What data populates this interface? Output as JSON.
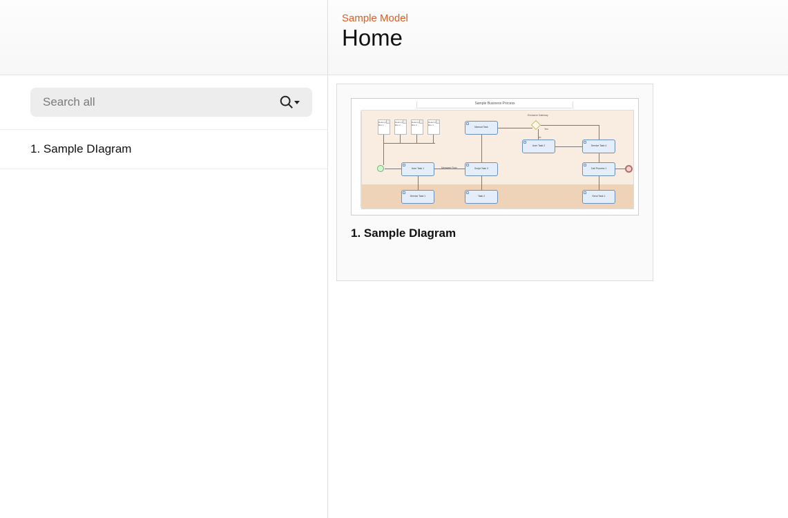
{
  "header": {
    "breadcrumb": "Sample Model",
    "title": "Home"
  },
  "search": {
    "placeholder": "Search all"
  },
  "sidebar": {
    "items": [
      {
        "label": "1. Sample DIagram"
      }
    ]
  },
  "cards": [
    {
      "title": "1. Sample DIagram",
      "preview_title": "Sample Business Process",
      "gateway_label": "Exclusive Gateway",
      "papers": [
        "Reference Box 1",
        "Reference Box 2",
        "Reference Box 3",
        "Reference Box 4"
      ],
      "tasks": {
        "manual": "Manual Task",
        "user2": "User Task 2",
        "service4": "Service Task 4",
        "user1": "User Task 1",
        "script3": "Script Task 3",
        "callproc": "Call Process 1",
        "svc1b": "Service Task 1",
        "task2b": "Task 2",
        "send1b": "Send Task 1",
        "message": "Message Flow"
      },
      "edge_labels": {
        "yes": "Yes",
        "no": "No"
      }
    }
  ]
}
